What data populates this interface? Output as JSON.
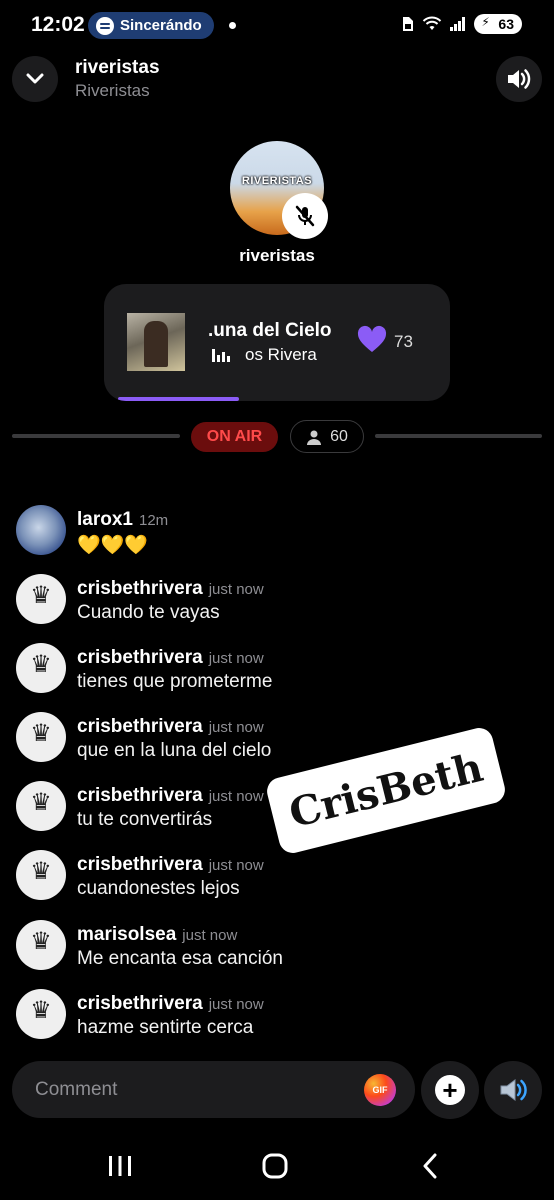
{
  "status_bar": {
    "time": "12:02",
    "spotify_pill": "Sincerándo",
    "battery": "63"
  },
  "header": {
    "title": "riveristas",
    "subtitle": "Riveristas",
    "host_avatar_text": "RIVERISTAS"
  },
  "host": {
    "name": "riveristas"
  },
  "now_playing": {
    "song_title": ".una del Cielo",
    "artist": "os Rivera",
    "likes": "73",
    "progress": 0.35
  },
  "live": {
    "on_air": "ON AIR",
    "listeners": "60"
  },
  "comments": [
    {
      "user": "larox1",
      "time": "12m",
      "text": "💛💛💛",
      "avatar": "moon"
    },
    {
      "user": "crisbethrivera",
      "time": "just now",
      "text": "Cuando te vayas",
      "avatar": "crown"
    },
    {
      "user": "crisbethrivera",
      "time": "just now",
      "text": "tienes que prometerme",
      "avatar": "crown"
    },
    {
      "user": "crisbethrivera",
      "time": "just now",
      "text": "que en la luna del cielo",
      "avatar": "crown"
    },
    {
      "user": "crisbethrivera",
      "time": "just now",
      "text": "tu te convertirás",
      "avatar": "crown"
    },
    {
      "user": "crisbethrivera",
      "time": "just now",
      "text": "cuandonestes lejos",
      "avatar": "crown"
    },
    {
      "user": "marisolsea",
      "time": "just now",
      "text": "Me encanta esa canción",
      "avatar": "crown"
    },
    {
      "user": "crisbethrivera",
      "time": "just now",
      "text": "hazme sentirte cerca",
      "avatar": "crown"
    }
  ],
  "sticker": {
    "text": "CrisBeth"
  },
  "composer": {
    "placeholder": "Comment",
    "gif_label": "GIF"
  },
  "colors": {
    "accent": "#8b5cf6",
    "on_air_bg": "#6b0d0d",
    "on_air_text": "#ff4a4a",
    "card_bg": "#1c1c1e"
  }
}
